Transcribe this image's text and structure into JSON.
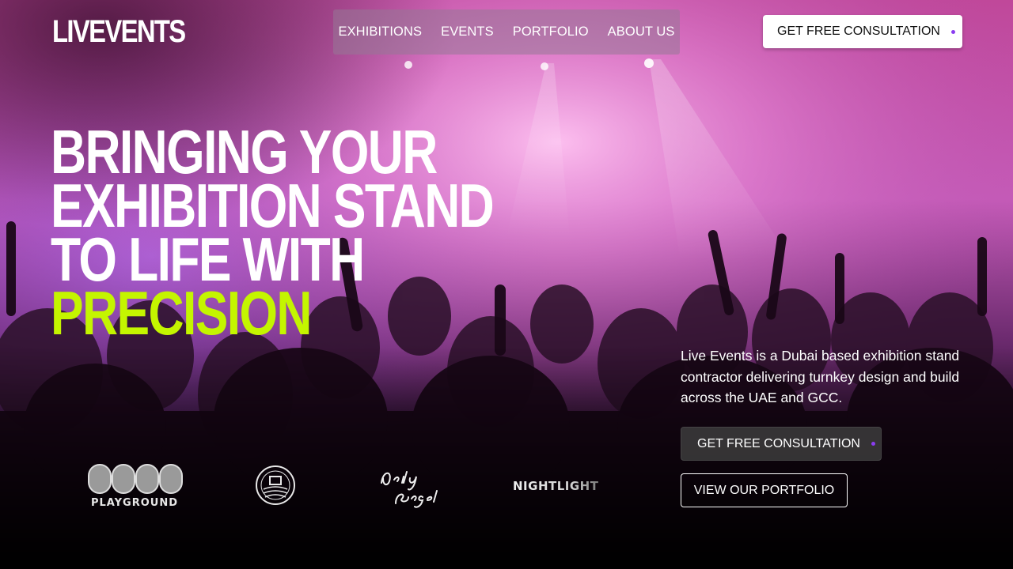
{
  "brand": {
    "logo_text": "LIVEVENTS"
  },
  "nav": {
    "items": [
      {
        "label": "EXHIBITIONS"
      },
      {
        "label": "EVENTS"
      },
      {
        "label": "PORTFOLIO"
      },
      {
        "label": "ABOUT US"
      }
    ]
  },
  "header": {
    "cta_label": "GET FREE CONSULTATION"
  },
  "hero": {
    "headline_lines": [
      "BRINGING YOUR",
      "EXHIBITION STAND",
      "TO LIFE WITH"
    ],
    "headline_accent": "PRECISION",
    "description": "Live Events is a Dubai based exhibition stand contractor delivering turnkey design and build across the UAE and GCC.",
    "primary_cta": "GET FREE CONSULTATION",
    "secondary_cta": "VIEW OUR PORTFOLIO"
  },
  "clients": [
    {
      "name": "PLAY PLAYGROUND",
      "icon": "play-playground-logo"
    },
    {
      "name": "CRUM COFFEE CO",
      "icon": "coffee-badge-logo"
    },
    {
      "name": "Daily Bagel",
      "icon": "daily-bagel-logo"
    },
    {
      "name": "NIGHTLIGHT",
      "icon": "nightlight-logo"
    }
  ],
  "colors": {
    "accent_lime": "#c4f500",
    "cta_dot_purple": "#8a3cf0",
    "haze_pink": "#e07ad8",
    "background": "#000000"
  }
}
